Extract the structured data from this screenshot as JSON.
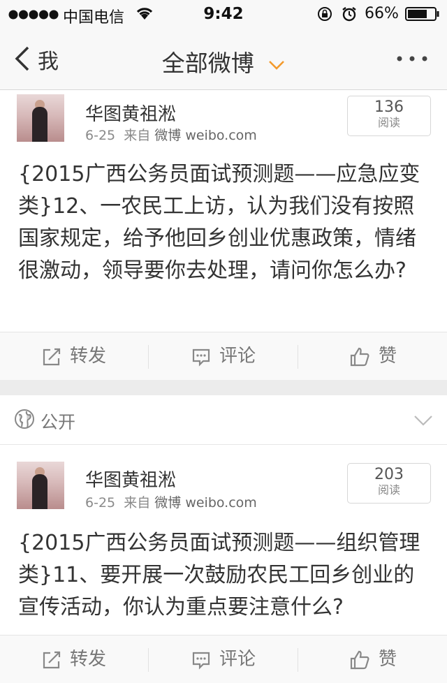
{
  "status": {
    "carrier": "中国电信",
    "time": "9:42",
    "battery": "66%"
  },
  "nav": {
    "back_label": "我",
    "title": "全部微博",
    "accent": "#f39a2c"
  },
  "posts": [
    {
      "author": "华图黄祖淞",
      "date": "6-25",
      "from_label": "来自",
      "source": "微博 weibo.com",
      "read_count": "136",
      "read_label": "阅读",
      "text": "{2015广西公务员面试预测题——应急应变类}12、一农民工上访，认为我们没有按照国家规定，给予他回乡创业优惠政策，情绪很激动，领导要你去处理，请问你怎么办?"
    },
    {
      "author": "华图黄祖淞",
      "date": "6-25",
      "from_label": "来自",
      "source": "微博 weibo.com",
      "read_count": "203",
      "read_label": "阅读",
      "text": "{2015广西公务员面试预测题——组织管理类}11、要开展一次鼓励农民工回乡创业的宣传活动，你认为重点要注意什么?"
    }
  ],
  "actions": {
    "repost": "转发",
    "comment": "评论",
    "like": "赞"
  },
  "visibility": {
    "label": "公开"
  }
}
